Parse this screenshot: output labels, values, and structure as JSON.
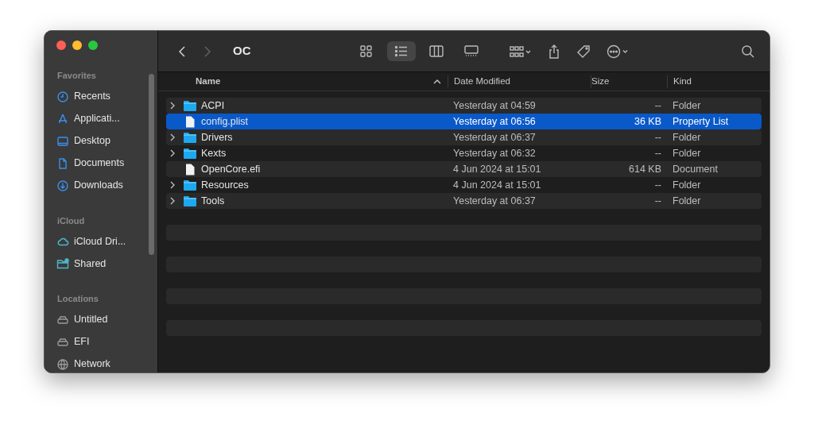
{
  "window": {
    "title": "OC"
  },
  "sidebar": {
    "sections": [
      {
        "title": "Favorites",
        "items": [
          {
            "label": "Recents"
          },
          {
            "label": "Applicati..."
          },
          {
            "label": "Desktop"
          },
          {
            "label": "Documents"
          },
          {
            "label": "Downloads"
          }
        ]
      },
      {
        "title": "iCloud",
        "items": [
          {
            "label": "iCloud Dri..."
          },
          {
            "label": "Shared"
          }
        ]
      },
      {
        "title": "Locations",
        "items": [
          {
            "label": "Untitled"
          },
          {
            "label": "EFI"
          },
          {
            "label": "Network"
          }
        ]
      }
    ]
  },
  "views": [
    {
      "selected": false
    },
    {
      "selected": true
    },
    {
      "selected": false
    },
    {
      "selected": false
    }
  ],
  "table": {
    "columns": [
      {
        "label": "Name",
        "sorted": true
      },
      {
        "label": "Date Modified",
        "sorted": false
      },
      {
        "label": "Size",
        "sorted": false
      },
      {
        "label": "Kind",
        "sorted": false
      }
    ],
    "rows": [
      {
        "kind": "folder",
        "name": "ACPI",
        "date": "Yesterday at 04:59",
        "size": "--",
        "type": "Folder",
        "selected": false
      },
      {
        "kind": "file",
        "name": "config.plist",
        "date": "Yesterday at 06:56",
        "size": "36 KB",
        "type": "Property List",
        "selected": true
      },
      {
        "kind": "folder",
        "name": "Drivers",
        "date": "Yesterday at 06:37",
        "size": "--",
        "type": "Folder",
        "selected": false
      },
      {
        "kind": "folder",
        "name": "Kexts",
        "date": "Yesterday at 06:32",
        "size": "--",
        "type": "Folder",
        "selected": false
      },
      {
        "kind": "file",
        "name": "OpenCore.efi",
        "date": "4 Jun 2024 at 15:01",
        "size": "614 KB",
        "type": "Document",
        "selected": false
      },
      {
        "kind": "folder",
        "name": "Resources",
        "date": "4 Jun 2024 at 15:01",
        "size": "--",
        "type": "Folder",
        "selected": false
      },
      {
        "kind": "folder",
        "name": "Tools",
        "date": "Yesterday at 06:37",
        "size": "--",
        "type": "Folder",
        "selected": false
      }
    ]
  }
}
